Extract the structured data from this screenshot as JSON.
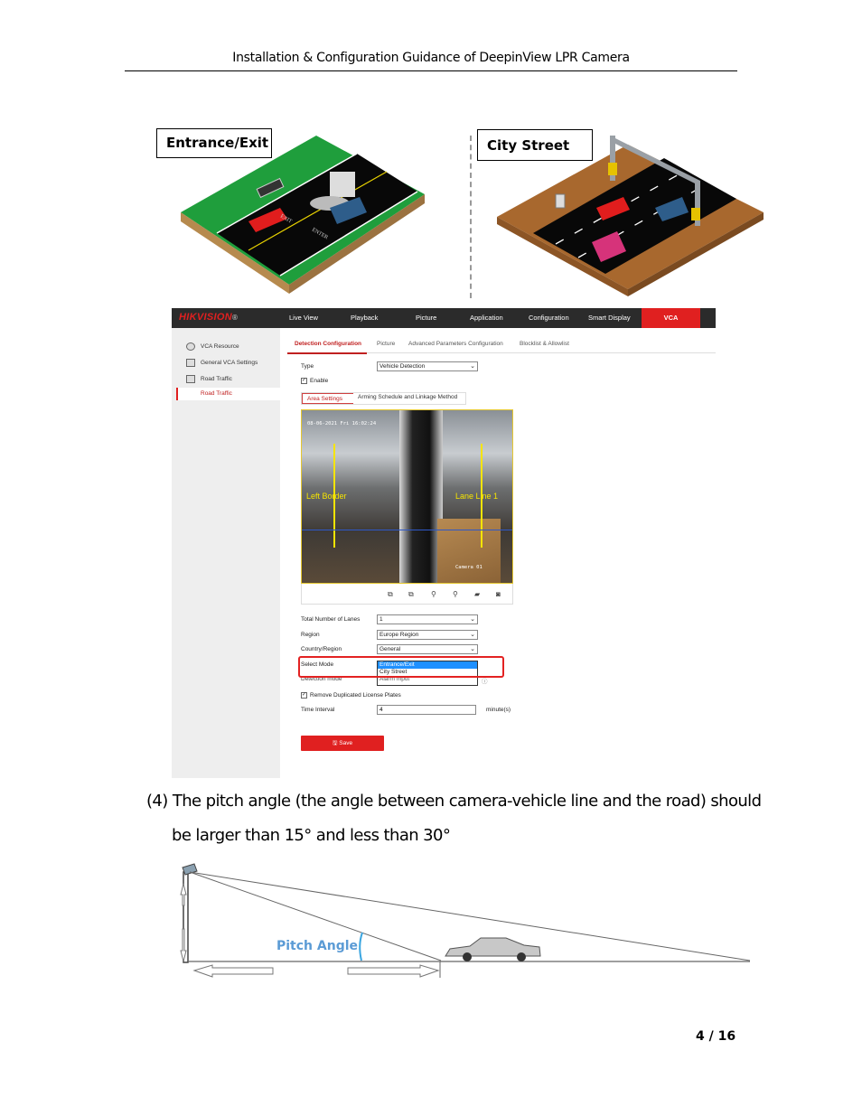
{
  "document": {
    "header": "Installation & Configuration Guidance of DeepinView LPR Camera",
    "page_number": "4 / 16"
  },
  "figure_scenes": {
    "left_label": "Entrance/Exit",
    "right_label": "City Street",
    "left_scene_signs": [
      "EXIT",
      "ENTER"
    ]
  },
  "ui": {
    "logo": {
      "brand": "HIK",
      "brand2": "VISION",
      "mark": "®"
    },
    "nav": [
      "Live View",
      "Playback",
      "Picture",
      "Application",
      "Configuration",
      "Smart Display",
      "VCA"
    ],
    "active_nav": "VCA",
    "sidebar": [
      {
        "label": "VCA Resource",
        "icon": "vca-resource-icon"
      },
      {
        "label": "General VCA Settings",
        "icon": "settings-grid-icon"
      },
      {
        "label": "Road Traffic",
        "icon": "road-traffic-icon"
      }
    ],
    "sidebar_active": "Road Traffic",
    "tabs": [
      "Detection Configuration",
      "Picture",
      "Advanced Parameters Configuration",
      "Blocklist & Allowlist"
    ],
    "active_tab": "Detection Configuration",
    "type_label": "Type",
    "type_value": "Vehicle Detection",
    "enable_label": "Enable",
    "enable_checked": true,
    "subtabs": [
      "Area Settings",
      "Arming Schedule and Linkage Method"
    ],
    "video": {
      "timestamp": "08-06-2021 Fri 16:02:24",
      "camera_name": "Camera 01",
      "left_border_label": "Left Border",
      "lane_line_label": "Lane Line 1",
      "line_color": "#f5e400"
    },
    "video_tools": [
      "window-icon",
      "window-alt-icon",
      "zoom-out-icon",
      "zoom-in-icon",
      "record-icon",
      "camera-icon"
    ],
    "fields": {
      "lanes_label": "Total Number of Lanes",
      "lanes_value": "1",
      "region_label": "Region",
      "region_value": "Europe Region",
      "country_label": "Country/Region",
      "country_value": "General",
      "select_mode_label": "Select Mode",
      "select_mode_options": [
        "Entrance/Exit",
        "City Street"
      ],
      "select_mode_selected": "Entrance/Exit",
      "detection_mode_label": "Detection mode",
      "detection_mode_value": "Alarm Input",
      "remove_dup_label": "Remove Duplicated License Plates",
      "remove_dup_checked": true,
      "time_interval_label": "Time Interval",
      "time_interval_value": "4",
      "time_interval_unit": "minute(s)"
    },
    "save_label": "Save",
    "accent_color": "#e02020"
  },
  "paragraph": {
    "line1": "(4) The pitch angle (the angle between camera-vehicle line and the road) should",
    "line2": "be larger than 15°  and less than 30°"
  },
  "pitch_figure": {
    "label": "Pitch Angle",
    "label_color": "#5b9bd5"
  }
}
